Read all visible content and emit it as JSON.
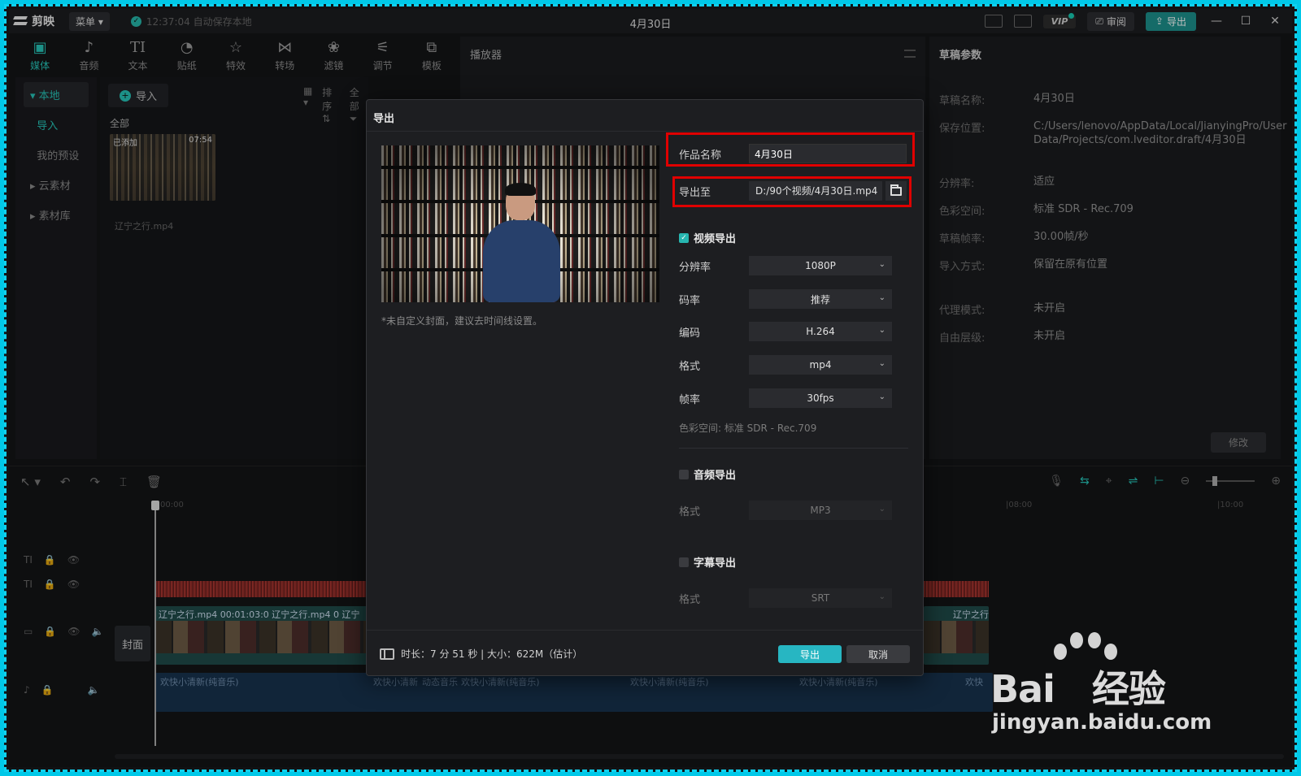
{
  "titlebar": {
    "app_name": "剪映",
    "menu_label": "菜单",
    "autosave": "12:37:04 自动保存本地",
    "project_title": "4月30日",
    "vip_label": "VIP",
    "review_label": "审阅",
    "export_label": "导出"
  },
  "toolbar": [
    {
      "label": "媒体",
      "icon": "media-icon",
      "glyph": "▣"
    },
    {
      "label": "音频",
      "icon": "audio-icon",
      "glyph": "♪"
    },
    {
      "label": "文本",
      "icon": "text-icon",
      "glyph": "TI"
    },
    {
      "label": "贴纸",
      "icon": "sticker-icon",
      "glyph": "◔"
    },
    {
      "label": "特效",
      "icon": "effects-icon",
      "glyph": "☆"
    },
    {
      "label": "转场",
      "icon": "transition-icon",
      "glyph": "⋈"
    },
    {
      "label": "滤镜",
      "icon": "filter-icon",
      "glyph": "❀"
    },
    {
      "label": "调节",
      "icon": "adjust-icon",
      "glyph": "⚟"
    },
    {
      "label": "模板",
      "icon": "template-icon",
      "glyph": "⧉"
    }
  ],
  "left_nav": {
    "local": "本地",
    "import": "导入",
    "presets": "我的预设",
    "cloud": "云素材",
    "library": "素材库"
  },
  "media": {
    "import_label": "导入",
    "sort_label": "排序",
    "filter_label": "全部",
    "all_label": "全部",
    "clip_badge": "已添加",
    "clip_duration": "07:54",
    "clip_name": "辽宁之行.mp4"
  },
  "player": {
    "title": "播放器"
  },
  "params": {
    "title": "草稿参数",
    "rows": [
      {
        "k": "草稿名称:",
        "v": "4月30日"
      },
      {
        "k": "保存位置:",
        "v": "C:/Users/lenovo/AppData/Local/JianyingPro/User Data/Projects/com.lveditor.draft/4月30日"
      },
      {
        "k": "分辨率:",
        "v": "适应"
      },
      {
        "k": "色彩空间:",
        "v": "标准 SDR - Rec.709"
      },
      {
        "k": "草稿帧率:",
        "v": "30.00帧/秒"
      },
      {
        "k": "导入方式:",
        "v": "保留在原有位置"
      },
      {
        "k": "代理模式:",
        "v": "未开启"
      },
      {
        "k": "自由层级:",
        "v": "未开启"
      }
    ],
    "modify_label": "修改"
  },
  "timeline": {
    "ruler": [
      "00:00",
      "|08:00",
      "|10:00"
    ],
    "cover_label": "封面",
    "clip_labels": "辽宁之行.mp4   00:01:03:0   辽宁之行.mp4   0   辽宁",
    "clip_label_right": "辽宁之行",
    "audio_labels": [
      "欢快小清新(纯音乐)",
      "欢快小清新",
      "动态音乐",
      "欢快小清新(纯音乐)",
      "欢快小清新(纯音乐)",
      "欢快小清新(纯音乐)",
      "欢快"
    ]
  },
  "dialog": {
    "title": "导出",
    "cover_note": "*未自定义封面，建议去时间线设置。",
    "name_label": "作品名称",
    "name_value": "4月30日",
    "export_to_label": "导出至",
    "export_path": "D:/90个视频/4月30日.mp4",
    "video_section": "视频导出",
    "resolution_label": "分辨率",
    "resolution_value": "1080P",
    "bitrate_label": "码率",
    "bitrate_value": "推荐",
    "codec_label": "编码",
    "codec_value": "H.264",
    "format_label": "格式",
    "format_value": "mp4",
    "fps_label": "帧率",
    "fps_value": "30fps",
    "colorspace": "色彩空间:  标准 SDR - Rec.709",
    "audio_section": "音频导出",
    "audio_format_label": "格式",
    "audio_format_value": "MP3",
    "subtitle_section": "字幕导出",
    "subtitle_format_label": "格式",
    "subtitle_format_value": "SRT",
    "footer_info": "时长：7 分 51 秒 | 大小：622M（估计）",
    "export_button": "导出",
    "cancel_button": "取消"
  },
  "watermark": {
    "brand": "Bai",
    "suffix": "经验",
    "url": "jingyan.baidu.com"
  },
  "colors": {
    "accent": "#26c2b6",
    "highlight": "#e00000",
    "export_btn": "#27b6c2"
  }
}
